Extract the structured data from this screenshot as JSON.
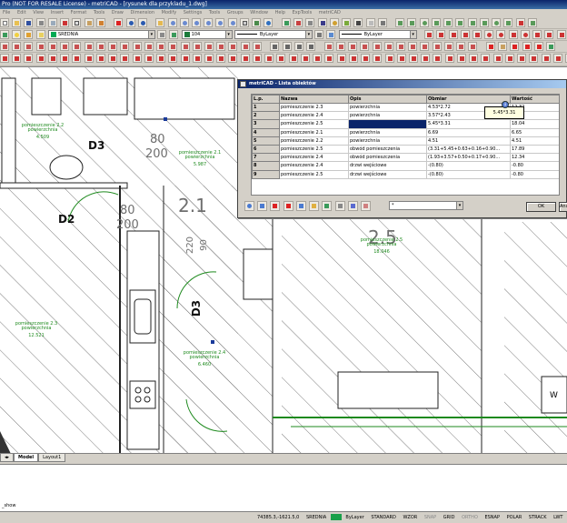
{
  "window": {
    "title": "Pro (NOT FOR RESALE License) - metriCAD - [rysunek dla przykladu_1.dwg]"
  },
  "menu": [
    "File",
    "Edit",
    "View",
    "Insert",
    "Format",
    "Tools",
    "Draw",
    "Dimension",
    "Modify",
    "Settings",
    "Tools",
    "Groups",
    "Window",
    "Help",
    "ExpTools",
    "metriCAD"
  ],
  "props": {
    "layer": "SREDNIA",
    "color": "104",
    "linetype": "ByLayer",
    "lineweight": "ByLayer",
    "colors": {
      "layer_swatch": "#00aa55",
      "color_swatch": "#1a7a3a"
    }
  },
  "drawing": {
    "door_labels": [
      "D3",
      "D2",
      "D3"
    ],
    "dims": [
      "80",
      "200",
      "80",
      "200",
      "2.1",
      "2.5",
      "220",
      "90"
    ],
    "rooms": [
      {
        "name": "pomieszczenie 2.2",
        "sub": "powierzchnia",
        "area": "4.509"
      },
      {
        "name": "pomieszczenie 2.1",
        "sub": "powierzchnia",
        "area": "5.987"
      },
      {
        "name": "pomieszczenie 2.5",
        "sub": "powierzchnia",
        "area": "18.046"
      },
      {
        "name": "pomieszczenie 2.3",
        "sub": "powierzchnia",
        "area": "12.521"
      },
      {
        "name": "pomieszczenie 2.4",
        "sub": "powierzchnia",
        "area": "6.460"
      }
    ],
    "window_mark": "W"
  },
  "dialog": {
    "title": "metriCAD - Lista obiektów",
    "columns": [
      "L.p.",
      "Nazwa",
      "Opis",
      "Obmiar",
      "Wartość"
    ],
    "rows": [
      {
        "n": "1",
        "name": "pomieszczenie 2.3",
        "desc": "powierzchnia",
        "formula": "4.53*2.72",
        "value": "12.32"
      },
      {
        "n": "2",
        "name": "pomieszczenie 2.4",
        "desc": "powierzchnia",
        "formula": "3.57*2.43",
        "value": "8.68"
      },
      {
        "n": "3",
        "name": "pomieszczenie 2.5",
        "desc": "",
        "formula": "5.45*3.31",
        "value": "18.04"
      },
      {
        "n": "4",
        "name": "pomieszczenie 2.1",
        "desc": "powierzchnia",
        "formula": "6.69",
        "value": "6.65"
      },
      {
        "n": "5",
        "name": "pomieszczenie 2.2",
        "desc": "powierzchnia",
        "formula": "4.51",
        "value": "4.51"
      },
      {
        "n": "6",
        "name": "pomieszczenie 2.5",
        "desc": "obwód pomieszczenia",
        "formula": "(3.31+5.45+0.63+0.16+0.90...",
        "value": "17.89"
      },
      {
        "n": "7",
        "name": "pomieszczenie 2.4",
        "desc": "obwód pomieszczenia",
        "formula": "(1.93+3.57+0.50+0.17+0.90...",
        "value": "12.34"
      },
      {
        "n": "8",
        "name": "pomieszczenie 2.4",
        "desc": "drzwi wejściowe",
        "formula": "-(0.80)",
        "value": "-0.80"
      },
      {
        "n": "9",
        "name": "pomieszczenie 2.5",
        "desc": "drzwi wejściowe",
        "formula": "-(0.80)",
        "value": "-0.80"
      }
    ],
    "tooltip": "5.45*3.31",
    "filter_value": "*",
    "ok_label": "OK",
    "cancel_label": "Anuluj"
  },
  "tabs": [
    "Model",
    "Layout1"
  ],
  "command": {
    "prompt": "_show"
  },
  "status": {
    "coords": "74385.3,-1621.5,0",
    "layer": "SREDNIA",
    "color_swatch": "#1aa04a",
    "linetype": "ByLayer",
    "textstyle": "STANDARD",
    "dimstyle": "WZOR",
    "toggles": [
      "SNAP",
      "GRID",
      "ORTHO",
      "ESNAP",
      "POLAR",
      "STRACK",
      "LWT"
    ]
  }
}
